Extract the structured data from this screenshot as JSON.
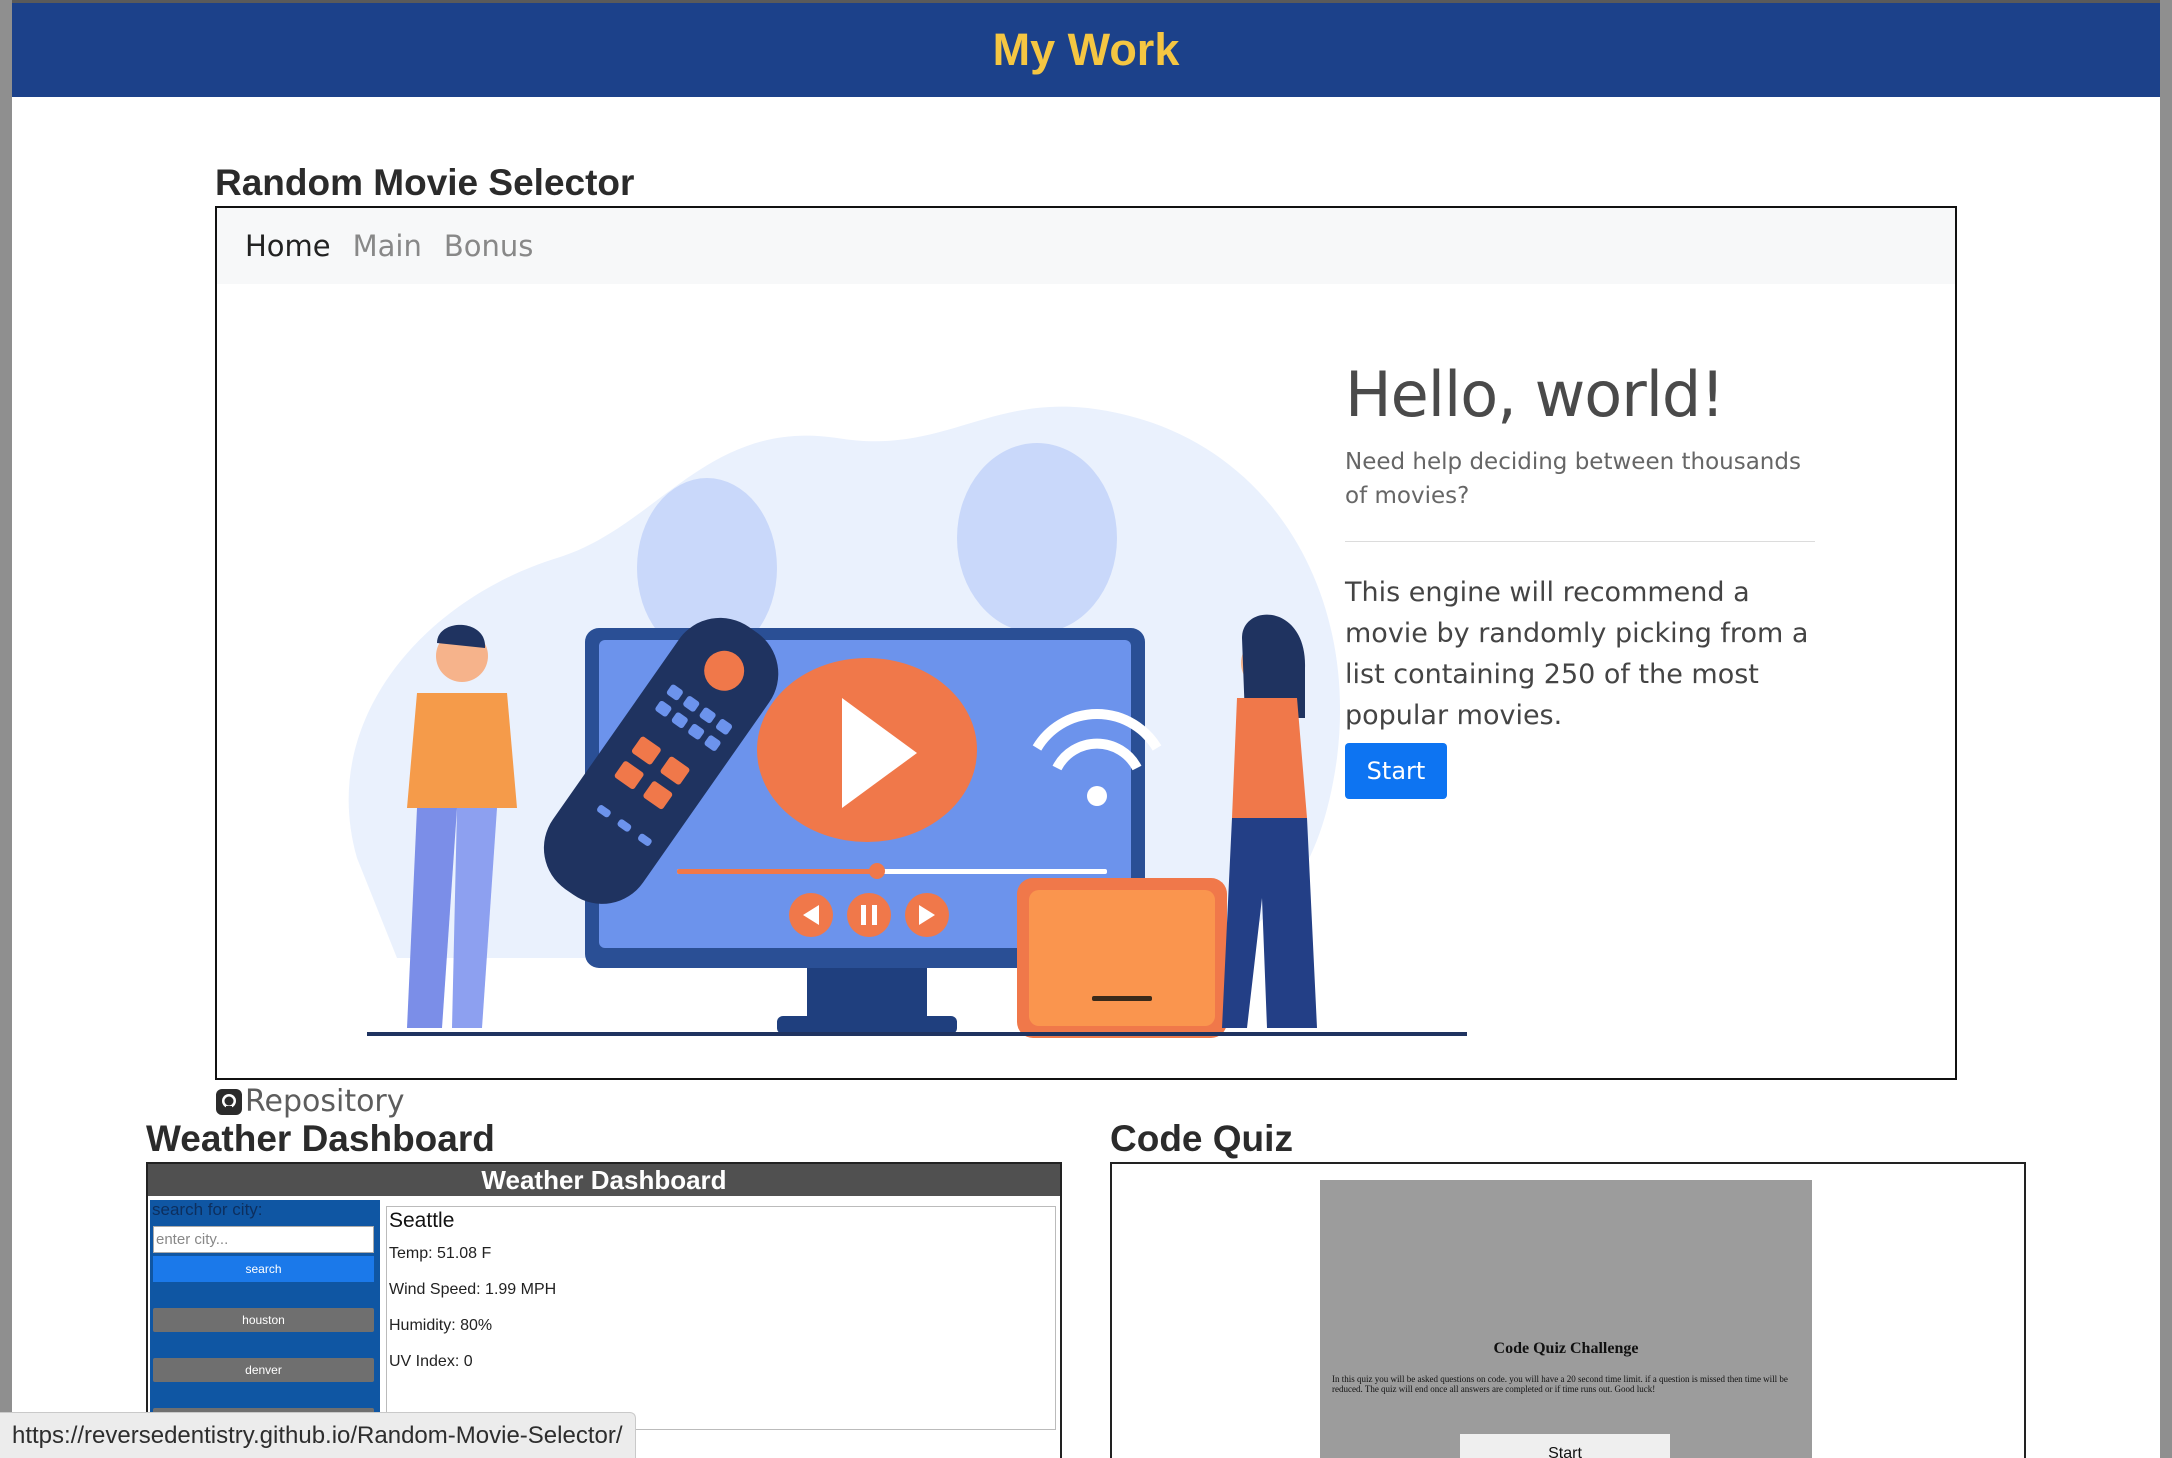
{
  "header": {
    "title": "My Work"
  },
  "projects": {
    "movie": {
      "title": "Random Movie Selector",
      "nav": [
        "Home",
        "Main",
        "Bonus"
      ],
      "hero_title": "Hello, world!",
      "lead": "Need help deciding between thousands of movies?",
      "body": "This engine will recommend a movie by randomly picking from a list containing 250 of the most popular movies.",
      "start_label": "Start",
      "repo_label": "Repository"
    },
    "weather": {
      "title": "Weather Dashboard",
      "app_header": "Weather Dashboard",
      "search_label": "search for city:",
      "search_placeholder": "enter city...",
      "search_button": "search",
      "cities": [
        "houston",
        "denver"
      ],
      "city_name": "Seattle",
      "temp": "Temp: 51.08 F",
      "wind": "Wind Speed: 1.99 MPH",
      "humidity": "Humidity: 80%",
      "uv": "UV Index: 0"
    },
    "quiz": {
      "title": "Code Quiz",
      "heading": "Code Quiz Challenge",
      "description": "In this quiz you will be asked questions on code. you will have a 20 second time limit. if a question is missed then time will be reduced. The quiz will end once all answers are completed or if time runs out. Good luck!",
      "start_label": "Start"
    }
  },
  "status_url": "https://reversedentistry.github.io/Random-Movie-Selector/",
  "colors": {
    "header_bg": "#1c418a",
    "header_text": "#f5c642",
    "start_button": "#0d74f2"
  }
}
